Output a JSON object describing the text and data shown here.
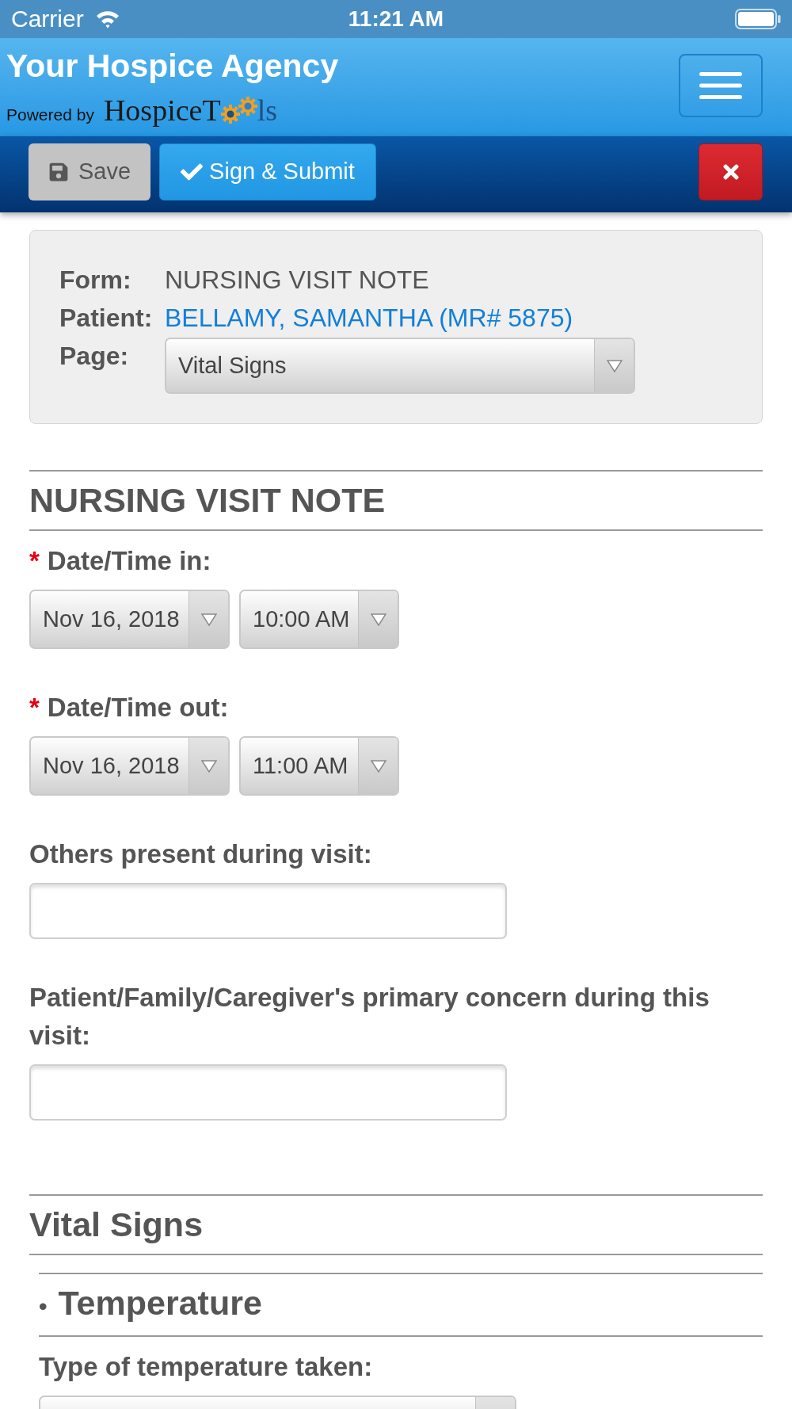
{
  "status_bar": {
    "carrier": "Carrier",
    "time": "11:21 AM"
  },
  "header": {
    "title": "Your Hospice Agency",
    "powered_by": "Powered by",
    "logo": {
      "text_start": "HospiceT",
      "text_end": "ls"
    }
  },
  "toolbar": {
    "buttons": [
      {
        "kind": "save",
        "label": "Save"
      },
      {
        "kind": "submit",
        "label": "Sign & Submit"
      },
      {
        "kind": "close"
      }
    ]
  },
  "info_panel": {
    "rows": [
      {
        "kind": "text",
        "label": "Form:",
        "value": "NURSING VISIT NOTE"
      },
      {
        "kind": "link",
        "label": "Patient:",
        "value": "BELLAMY, SAMANTHA (MR# 5875)"
      },
      {
        "kind": "select",
        "label": "Page:",
        "value": "Vital Signs"
      }
    ]
  },
  "sections": [
    {
      "title": "NURSING VISIT NOTE",
      "fields": [
        {
          "kind": "datetime",
          "required_mark": "*",
          "label": "Date/Time in:",
          "date": "Nov 16, 2018",
          "time": "10:00 AM"
        },
        {
          "kind": "datetime",
          "required_mark": "*",
          "label": "Date/Time out:",
          "date": "Nov 16, 2018",
          "time": "11:00 AM"
        },
        {
          "kind": "text",
          "label": "Others present during visit:"
        },
        {
          "kind": "text",
          "label": "Patient/Family/Caregiver's primary concern during this visit:"
        }
      ]
    },
    {
      "title": "Vital Signs",
      "subsections": [
        {
          "bullet": "•",
          "title": "Temperature",
          "fields": [
            {
              "kind": "select",
              "label": "Type of temperature taken:"
            }
          ]
        }
      ]
    }
  ]
}
